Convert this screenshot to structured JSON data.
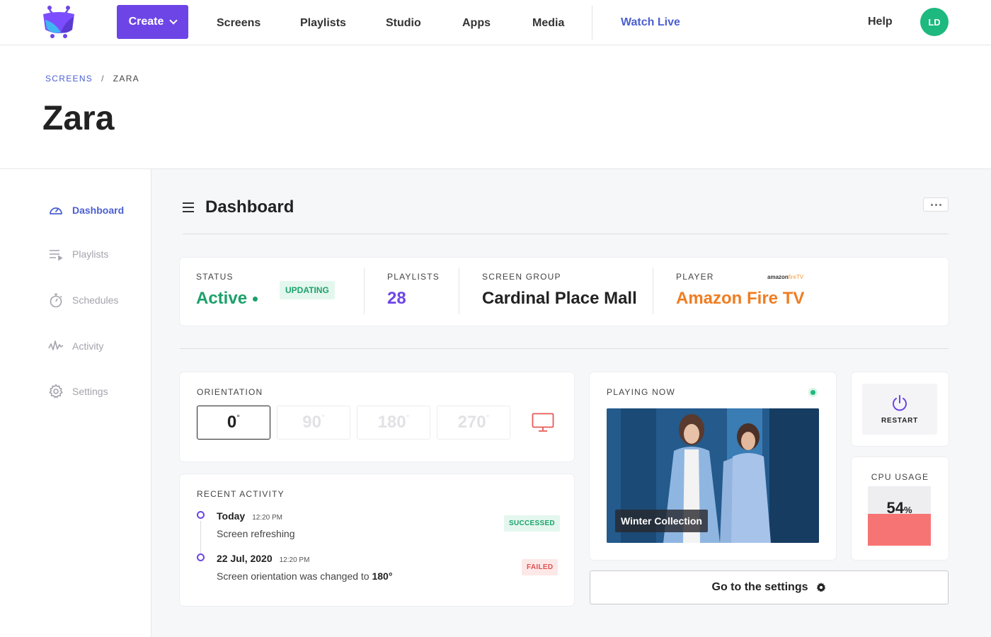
{
  "nav": {
    "create_label": "Create",
    "items": [
      "Screens",
      "Playlists",
      "Studio",
      "Apps",
      "Media"
    ],
    "watch_live": "Watch Live",
    "help": "Help",
    "avatar_initials": "LD"
  },
  "breadcrumb": {
    "parent": "SCREENS",
    "separator": "/",
    "current": "ZARA"
  },
  "page_title": "Zara",
  "sidebar": {
    "items": [
      {
        "label": "Dashboard",
        "icon": "gauge-icon",
        "active": true
      },
      {
        "label": "Playlists",
        "icon": "playlist-icon",
        "active": false
      },
      {
        "label": "Schedules",
        "icon": "stopwatch-icon",
        "active": false
      },
      {
        "label": "Activity",
        "icon": "activity-wave-icon",
        "active": false
      },
      {
        "label": "Settings",
        "icon": "gear-icon",
        "active": false
      }
    ]
  },
  "dashboard": {
    "title": "Dashboard",
    "status": {
      "label": "STATUS",
      "value": "Active",
      "badge": "UPDATING",
      "color": "#1ca16b"
    },
    "playlists": {
      "label": "PLAYLISTS",
      "value": "28",
      "color": "#6d45e6"
    },
    "screen_group": {
      "label": "SCREEN GROUP",
      "value": "Cardinal Place Mall"
    },
    "player": {
      "label": "PLAYER",
      "value": "Amazon Fire TV",
      "logo_text": "amazon",
      "logo_suffix": "fireTV",
      "color": "#ef7d22"
    },
    "orientation": {
      "label": "ORIENTATION",
      "options": [
        "0",
        "90",
        "180",
        "270"
      ],
      "degree_symbol": "°",
      "selected": "0"
    },
    "recent_activity": {
      "label": "RECENT ACTIVITY",
      "items": [
        {
          "date": "Today",
          "time": "12:20 PM",
          "description": "Screen refreshing",
          "highlight": "",
          "status": "SUCCESSED"
        },
        {
          "date": "22 Jul, 2020",
          "time": "12:20 PM",
          "description": "Screen orientation was changed to ",
          "highlight": "180°",
          "status": "FAILED"
        }
      ]
    },
    "playing_now": {
      "label": "PLAYING NOW",
      "caption": "Winter Collection"
    },
    "restart": {
      "label": "RESTART"
    },
    "cpu": {
      "label": "CPU USAGE",
      "value": "54",
      "unit": "%",
      "percent": 54
    },
    "settings_button": "Go to the settings"
  },
  "colors": {
    "brand": "#6d45e6",
    "link": "#4b5fd1",
    "success": "#1ca16b",
    "danger": "#e0514f",
    "cpu_fill": "#f77474"
  }
}
